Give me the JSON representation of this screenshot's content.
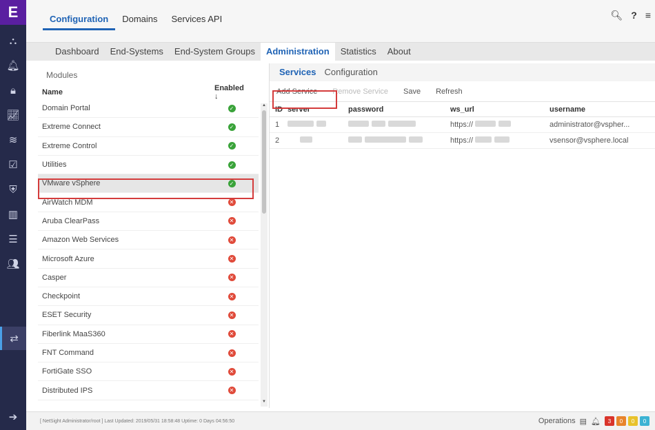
{
  "topbar": {
    "tabs": [
      "Configuration",
      "Domains",
      "Services API"
    ],
    "icons": [
      "search-icon",
      "help-icon",
      "menu-icon"
    ]
  },
  "subtabs": [
    "Dashboard",
    "End-Systems",
    "End-System Groups",
    "Administration",
    "Statistics",
    "About"
  ],
  "modules": {
    "title": "Modules",
    "col_name": "Name",
    "col_enabled": "Enabled",
    "rows": [
      {
        "name": "Domain Portal",
        "enabled": true
      },
      {
        "name": "Extreme Connect",
        "enabled": true
      },
      {
        "name": "Extreme Control",
        "enabled": true
      },
      {
        "name": "Utilities",
        "enabled": true
      },
      {
        "name": "VMware vSphere",
        "enabled": true
      },
      {
        "name": "AirWatch MDM",
        "enabled": false
      },
      {
        "name": "Aruba ClearPass",
        "enabled": false
      },
      {
        "name": "Amazon Web Services",
        "enabled": false
      },
      {
        "name": "Microsoft Azure",
        "enabled": false
      },
      {
        "name": "Casper",
        "enabled": false
      },
      {
        "name": "Checkpoint",
        "enabled": false
      },
      {
        "name": "ESET Security",
        "enabled": false
      },
      {
        "name": "Fiberlink MaaS360",
        "enabled": false
      },
      {
        "name": "FNT Command",
        "enabled": false
      },
      {
        "name": "FortiGate SSO",
        "enabled": false
      },
      {
        "name": "Distributed IPS",
        "enabled": false
      }
    ]
  },
  "right": {
    "tabs": [
      "Services",
      "Configuration"
    ],
    "toolbar": {
      "add": "Add Service",
      "remove": "Remove Service",
      "save": "Save",
      "refresh": "Refresh"
    },
    "columns": {
      "id": "ID",
      "server": "server",
      "password": "password",
      "ws_url": "ws_url",
      "username": "username"
    },
    "rows": [
      {
        "id": "1",
        "ws_url": "https://",
        "username": "administrator@vspher..."
      },
      {
        "id": "2",
        "ws_url": "https://",
        "username": "vsensor@vsphere.local"
      }
    ]
  },
  "statusbar": {
    "text": "[ NetSight Administrator/root ] Last Updated: 2019/05/31 18:58:48 Uptime: 0 Days 04:56:50",
    "operations": "Operations",
    "badges": [
      {
        "label": "3",
        "color": "#d9342b"
      },
      {
        "label": "0",
        "color": "#e8842b"
      },
      {
        "label": "0",
        "color": "#e8c22b"
      },
      {
        "label": "0",
        "color": "#3bb3d3"
      }
    ]
  },
  "colors": {
    "accent": "#1f63b5",
    "nav_bg": "#252a4a",
    "logo": "#5a1fa0",
    "highlight_box": "#d43b3b"
  }
}
